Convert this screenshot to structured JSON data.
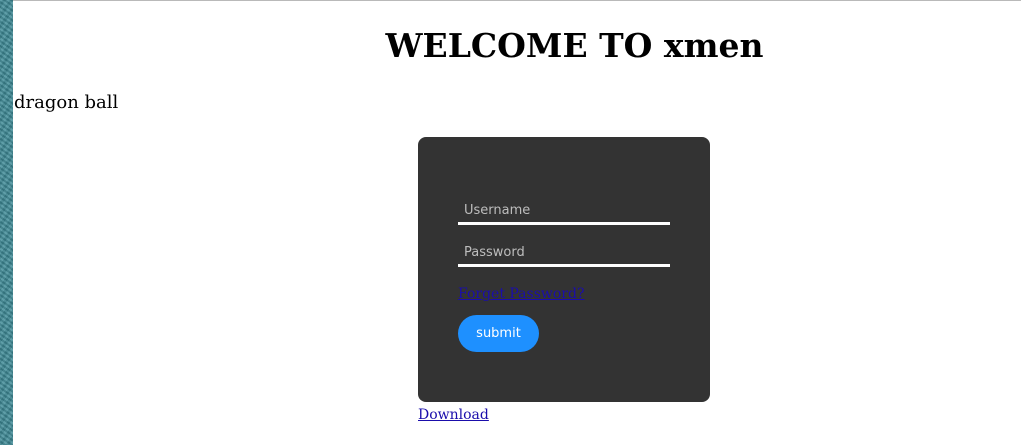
{
  "header": {
    "title": "WELCOME TO xmen",
    "subtitle": "dragon ball"
  },
  "login": {
    "username_placeholder": "Username",
    "username_value": "",
    "password_placeholder": "Password",
    "password_value": "",
    "forgot_label": "Forget Password?",
    "submit_label": "submit"
  },
  "footer": {
    "download_label": "Download"
  },
  "colors": {
    "card_background": "#333333",
    "submit_button": "#1e90ff",
    "link": "#1a0dab",
    "side_texture": "#3e8a96"
  }
}
